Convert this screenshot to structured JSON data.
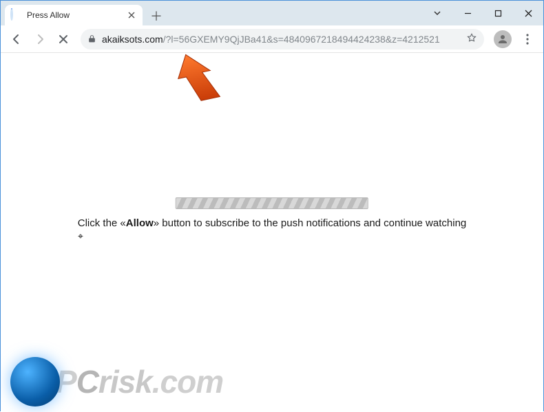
{
  "tab": {
    "title": "Press Allow",
    "loading": true
  },
  "toolbar": {
    "nav_back_icon": "arrow-left",
    "nav_forward_icon": "arrow-right",
    "stop_icon": "x"
  },
  "address": {
    "domain": "akaiksots.com",
    "path": "/?l=56GXEMY9QjJBa41&s=4840967218494424238&z=4212521"
  },
  "page": {
    "prompt_prefix": "Click the «",
    "prompt_allow": "Allow",
    "prompt_suffix": "» button to subscribe to the push notifications and continue watching"
  },
  "watermark": {
    "p": "P",
    "c": "C",
    "risk": "risk",
    "dotcom": ".com"
  },
  "annotation": {
    "arrow_color": "#e8531b"
  }
}
